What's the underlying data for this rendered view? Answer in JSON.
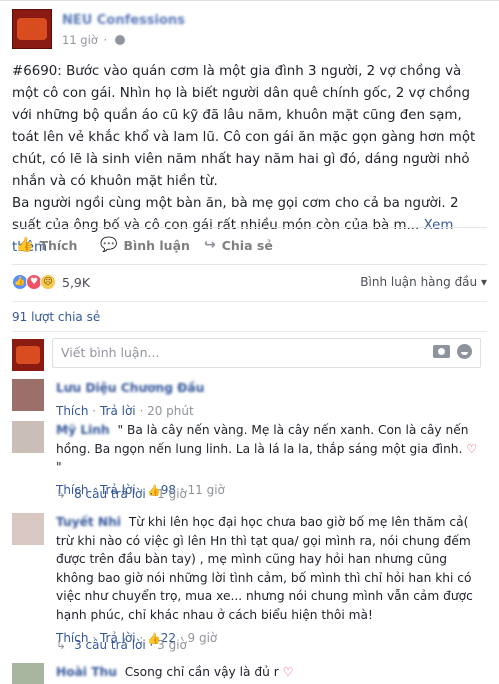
{
  "post": {
    "page_name": "NEU Confessions",
    "time": "11 giờ",
    "text_p1": "#6690: Bước vào quán cơm là một gia đình 3 người, 2 vợ chồng và một cô con gái. Nhìn họ là biết người dân quê chính gốc, 2 vợ chồng với những bộ quần áo cũ kỹ đã lâu năm, khuôn mặt cũng đen sạm, toát lên vẻ khắc khổ và lam lũ. Cô con gái ăn mặc gọn gàng hơn một chút, có lẽ là sinh viên năm nhất hay năm hai gì đó, dáng người nhỏ nhắn và có khuôn mặt hiền từ.",
    "text_p2": "Ba người ngồi cùng một bàn ăn, bà mẹ gọi cơm cho cả ba người. 2 suất của ông bố và cô con gái rất nhiều món còn của bà m...",
    "see_more": "Xem thêm"
  },
  "actions": {
    "like": "Thích",
    "comment": "Bình luận",
    "share": "Chia sẻ"
  },
  "reactions": {
    "count": "5,9K",
    "order_label": "Bình luận hàng đầu"
  },
  "shares_label": "91 lượt chia sẻ",
  "composer": {
    "placeholder": "Viết bình luận..."
  },
  "comments": [
    {
      "name": "Lưu Diệu Chương Đầu",
      "text": "",
      "like_label": "Thích",
      "reply_label": "Trả lời",
      "time": "20 phút",
      "likes": ""
    },
    {
      "name": "Mỹ Linh",
      "text": "\" Ba là cây nến vàng. Mẹ là cây nến xanh. Con là cây nến hồng. Ba ngọn nến lung linh. La là lá la la, thắp sáng một gia đình.",
      "text_end": " \"",
      "like_label": "Thích",
      "reply_label": "Trả lời",
      "likes": "98",
      "time": "11 giờ",
      "replies": "8 câu trả lời",
      "replies_age": "1 giờ"
    },
    {
      "name": "Tuyết Nhi",
      "text": "Từ khi lên học đại học chưa bao giờ bố mẹ lên thăm cả( trừ khi nào có việc gì lên Hn thì tạt qua/ gọi mình ra, nói chung đếm được trên đầu bàn tay) , mẹ mình cũng hay hỏi han nhưng cũng không bao giờ nói những lời tình cảm, bố mình thì chỉ hỏi han khi có việc như chuyển trọ, mua xe... nhưng nói chung mình vẫn cảm được hạnh phúc, chỉ khác nhau ở cách biểu hiện thôi mà!",
      "like_label": "Thích",
      "reply_label": "Trả lời",
      "likes": "22",
      "time": "9 giờ",
      "replies": "3 câu trả lời",
      "replies_age": "3 giờ"
    },
    {
      "name": "Hoài Thu",
      "text": "Csong chỉ cần vậy là đủ r"
    }
  ],
  "colors": {
    "link": "#365899",
    "like_blue": "#5890ff",
    "love_red": "#f25268"
  }
}
